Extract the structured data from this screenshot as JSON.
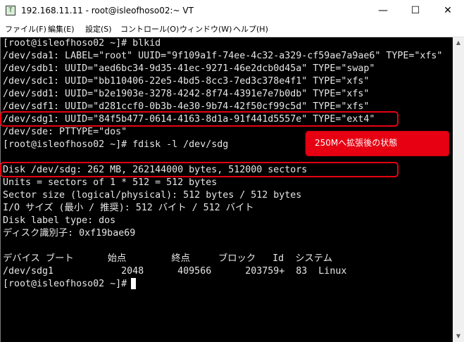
{
  "window": {
    "title": "192.168.11.11 - root@isleofhoso02:~ VT",
    "app_icon_glyph": "T",
    "minimize_glyph": "—",
    "maximize_glyph": "☐",
    "close_glyph": "✕"
  },
  "menu": [
    {
      "label": "ファイル(F)"
    },
    {
      "label": "編集(E)"
    },
    {
      "label": "設定(S)"
    },
    {
      "label": "コントロール(O)"
    },
    {
      "label": "ウィンドウ(W)"
    },
    {
      "label": "ヘルプ(H)"
    }
  ],
  "terminal": {
    "lines": [
      "[root@isleofhoso02 ~]# blkid",
      "/dev/sda1: LABEL=\"root\" UUID=\"9f109a1f-74ee-4c32-a329-cf59ae7a9ae6\" TYPE=\"xfs\"",
      "/dev/sdb1: UUID=\"aed6bc34-9d35-41ec-9271-46e2dcb0d45a\" TYPE=\"swap\"",
      "/dev/sdc1: UUID=\"bb110406-22e5-4bd5-8cc3-7ed3c378e4f1\" TYPE=\"xfs\"",
      "/dev/sdd1: UUID=\"b2e1903e-3278-4242-8f74-4391e7e7b0db\" TYPE=\"xfs\"",
      "/dev/sdf1: UUID=\"d281ccf0-0b3b-4e30-9b74-42f50cf99c5d\" TYPE=\"xfs\"",
      "/dev/sdg1: UUID=\"84f5b477-0614-4163-8d1a-91f441d5557e\" TYPE=\"ext4\"",
      "/dev/sde: PTTYPE=\"dos\"",
      "[root@isleofhoso02 ~]# fdisk -l /dev/sdg",
      "",
      "Disk /dev/sdg: 262 MB, 262144000 bytes, 512000 sectors",
      "Units = sectors of 1 * 512 = 512 bytes",
      "Sector size (logical/physical): 512 bytes / 512 bytes",
      "I/O サイズ (最小 / 推奨): 512 バイト / 512 バイト",
      "Disk label type: dos",
      "ディスク識別子: 0xf19bae69",
      "",
      "デバイス ブート      始点        終点     ブロック   Id  システム",
      "/dev/sdg1            2048      409566      203759+  83  Linux",
      "[root@isleofhoso02 ~]# "
    ]
  },
  "annotation": {
    "callout_text": "250Mへ拡張後の状態",
    "color": "#e60012"
  }
}
